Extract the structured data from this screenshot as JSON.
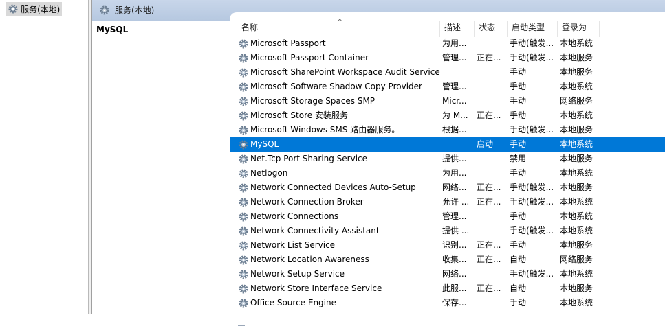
{
  "tree": {
    "node_label": "服务(本地)"
  },
  "header": {
    "title": "服务(本地)"
  },
  "detail": {
    "service_title": "MySQL"
  },
  "columns": {
    "name": "名称",
    "desc": "描述",
    "status": "状态",
    "startup": "启动类型",
    "logon": "登录为"
  },
  "sort_indicator": "^",
  "services": [
    {
      "name": "Microsoft Passport",
      "desc": "为用...",
      "status": "",
      "startup": "手动(触发...",
      "logon": "本地系统"
    },
    {
      "name": "Microsoft Passport Container",
      "desc": "管理...",
      "status": "正在...",
      "startup": "手动(触发...",
      "logon": "本地服务"
    },
    {
      "name": "Microsoft SharePoint Workspace Audit Service",
      "desc": "",
      "status": "",
      "startup": "手动",
      "logon": "本地服务"
    },
    {
      "name": "Microsoft Software Shadow Copy Provider",
      "desc": "管理...",
      "status": "",
      "startup": "手动",
      "logon": "本地系统"
    },
    {
      "name": "Microsoft Storage Spaces SMP",
      "desc": "Micr...",
      "status": "",
      "startup": "手动",
      "logon": "网络服务"
    },
    {
      "name": "Microsoft Store 安装服务",
      "desc": "为 M...",
      "status": "正在...",
      "startup": "手动",
      "logon": "本地系统"
    },
    {
      "name": "Microsoft Windows SMS 路由器服务。",
      "desc": "根据...",
      "status": "",
      "startup": "手动(触发...",
      "logon": "本地服务"
    },
    {
      "name": "MySQL",
      "desc": "",
      "status": "启动",
      "startup": "手动",
      "logon": "本地系统",
      "selected": true
    },
    {
      "name": "Net.Tcp Port Sharing Service",
      "desc": "提供...",
      "status": "",
      "startup": "禁用",
      "logon": "本地服务"
    },
    {
      "name": "Netlogon",
      "desc": "为用...",
      "status": "",
      "startup": "手动",
      "logon": "本地系统"
    },
    {
      "name": "Network Connected Devices Auto-Setup",
      "desc": "网络...",
      "status": "正在...",
      "startup": "手动(触发...",
      "logon": "本地服务"
    },
    {
      "name": "Network Connection Broker",
      "desc": "允许 ...",
      "status": "正在...",
      "startup": "手动(触发...",
      "logon": "本地系统"
    },
    {
      "name": "Network Connections",
      "desc": "管理...",
      "status": "",
      "startup": "手动",
      "logon": "本地系统"
    },
    {
      "name": "Network Connectivity Assistant",
      "desc": "提供 ...",
      "status": "",
      "startup": "手动(触发...",
      "logon": "本地系统"
    },
    {
      "name": "Network List Service",
      "desc": "识别...",
      "status": "正在...",
      "startup": "手动",
      "logon": "本地服务"
    },
    {
      "name": "Network Location Awareness",
      "desc": "收集...",
      "status": "正在...",
      "startup": "自动",
      "logon": "网络服务"
    },
    {
      "name": "Network Setup Service",
      "desc": "网络...",
      "status": "",
      "startup": "手动(触发...",
      "logon": "本地系统"
    },
    {
      "name": "Network Store Interface Service",
      "desc": "此服...",
      "status": "正在...",
      "startup": "自动",
      "logon": "本地服务"
    },
    {
      "name": "Office  Source Engine",
      "desc": "保存...",
      "status": "",
      "startup": "手动",
      "logon": "本地系统"
    }
  ],
  "icons": {
    "service": "gear-icon",
    "header": "gear-icon"
  },
  "colors": {
    "selection": "#0078d7",
    "header_bg": "#c8d6ea"
  }
}
